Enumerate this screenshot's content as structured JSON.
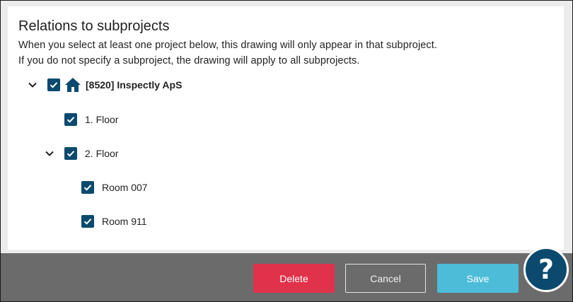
{
  "dialog": {
    "title": "Relations to subprojects",
    "description_line1": "When you select at least one project below, this drawing will only appear in that subproject.",
    "description_line2": "If you do not specify a subproject, the drawing will apply to all subprojects."
  },
  "tree": {
    "root": {
      "label": "[8520] Inspectly ApS",
      "checked": true,
      "expanded": true
    },
    "floor1": {
      "label": "1. Floor",
      "checked": true
    },
    "floor2": {
      "label": "2. Floor",
      "checked": true,
      "expanded": true
    },
    "room007": {
      "label": "Room 007",
      "checked": true
    },
    "room911": {
      "label": "Room 911",
      "checked": true
    }
  },
  "footer": {
    "delete_label": "Delete",
    "cancel_label": "Cancel",
    "save_label": "Save"
  },
  "help": {
    "symbol": "?"
  },
  "colors": {
    "checkbox": "#0b4a6e",
    "delete": "#e0324a",
    "save": "#4cbcd8",
    "footer": "#6b6b6b",
    "help": "#0b4a6e"
  },
  "icons": {
    "expand": "chevron-down-icon",
    "check": "check-icon",
    "home": "home-icon",
    "help": "question-mark-icon"
  }
}
